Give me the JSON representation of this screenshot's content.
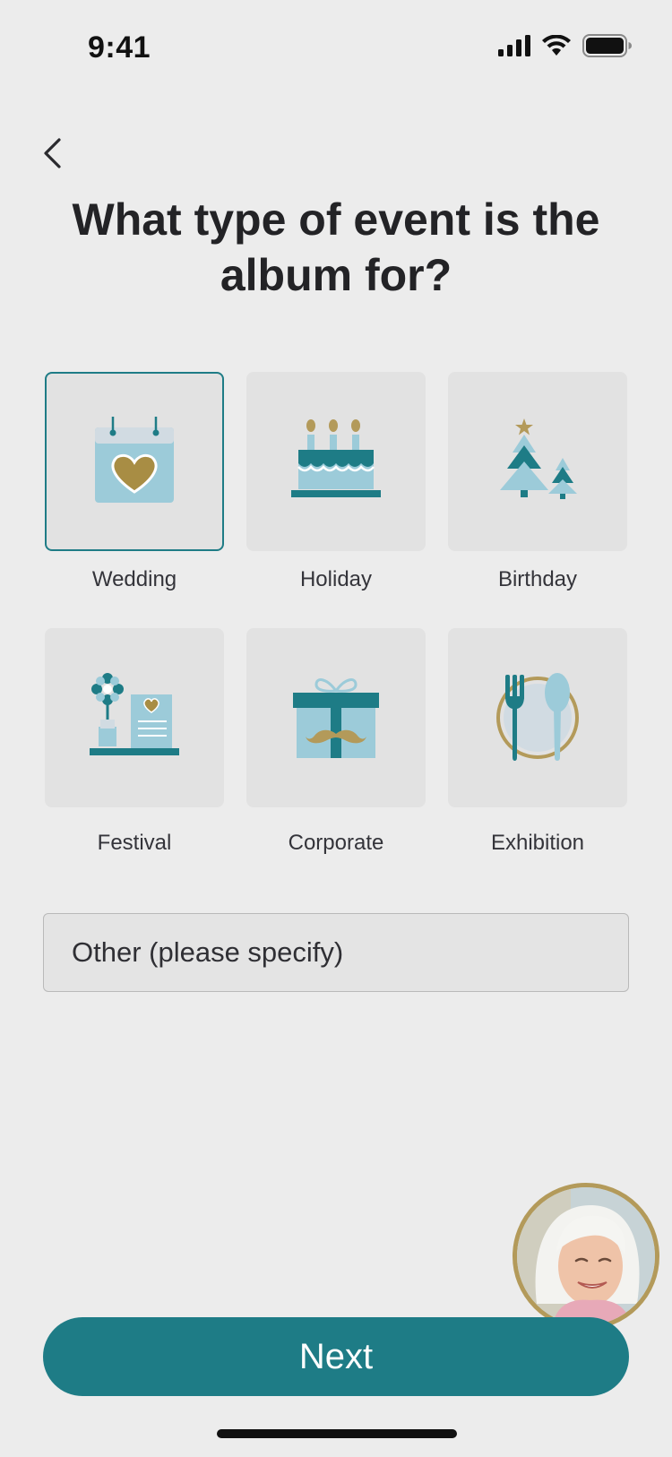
{
  "status_bar": {
    "time": "9:41",
    "icons": [
      "signal-icon",
      "wifi-icon",
      "battery-icon"
    ]
  },
  "header": {
    "back_icon": "chevron-left-icon",
    "title": "What type of event is the album for?"
  },
  "event_types": [
    {
      "label": "Wedding",
      "icon": "calendar-heart-icon",
      "selected": true
    },
    {
      "label": "Holiday",
      "icon": "birthday-cake-icon",
      "selected": false
    },
    {
      "label": "Birthday",
      "icon": "christmas-trees-icon",
      "selected": false
    },
    {
      "label": "Festival",
      "icon": "flower-card-icon",
      "selected": false
    },
    {
      "label": "Corporate",
      "icon": "gift-mustache-icon",
      "selected": false
    },
    {
      "label": "Exhibition",
      "icon": "plate-cutlery-icon",
      "selected": false
    }
  ],
  "other_field": {
    "placeholder": "Other (please specify)",
    "value": ""
  },
  "footer": {
    "next_label": "Next"
  },
  "colors": {
    "background": "#ececec",
    "accent_teal": "#1e7c86",
    "light_blue": "#9ccbd9",
    "gold": "#b39a5a",
    "card": "#e2e2e2"
  }
}
